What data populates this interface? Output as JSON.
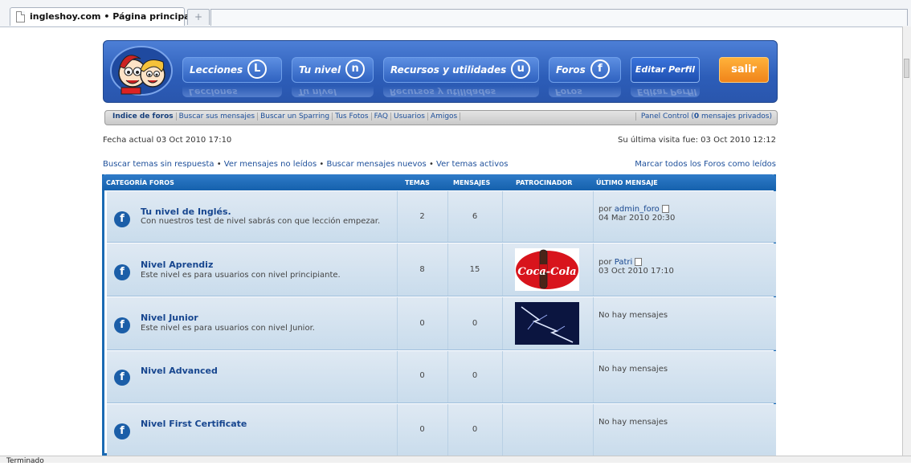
{
  "browser": {
    "tab_title": "ingleshoy.com • Página principal",
    "new_tab": "+"
  },
  "header": {
    "nav": [
      {
        "label": "Lecciones",
        "glyph": "L"
      },
      {
        "label": "Tu nivel",
        "glyph": "n"
      },
      {
        "label": "Recursos y utilidades",
        "glyph": "u"
      },
      {
        "label": "Foros",
        "glyph": "f"
      }
    ],
    "edit_profile": "Editar Perfil",
    "logout": "salir"
  },
  "linkbar": {
    "items": [
      "Indice de foros",
      "Buscar sus mensajes",
      "Buscar un Sparring",
      "Tus Fotos",
      "FAQ",
      "Usuarios",
      "Amigos"
    ],
    "panel_pre": "Panel Control (",
    "panel_count": "0",
    "panel_post": " mensajes privados)"
  },
  "info": {
    "current_date": "Fecha actual 03 Oct 2010 17:10",
    "last_visit": "Su última visita fue: 03 Oct 2010 12:12"
  },
  "quicklinks": [
    "Buscar temas sin respuesta",
    "Ver mensajes no leídos",
    "Buscar mensajes nuevos",
    "Ver temas activos"
  ],
  "mark_all": "Marcar todos los Foros como leídos",
  "table": {
    "headers": {
      "category": "CATEGORÍA FOROS",
      "topics": "TEMAS",
      "posts": "MENSAJES",
      "sponsor": "PATROCINADOR",
      "last": "ÚLTIMO MENSAJE"
    },
    "rows": [
      {
        "name": "Tu nivel de Inglés.",
        "desc": "Con nuestros test de nivel sabrás con que lección empezar.",
        "topics": "2",
        "posts": "6",
        "last_by": "por ",
        "last_author": "admin_foro",
        "last_date": "04 Mar 2010 20:30",
        "sponsor": ""
      },
      {
        "name": "Nivel Aprendiz",
        "desc": "Este nivel es para usuarios con nivel principiante.",
        "topics": "8",
        "posts": "15",
        "last_by": "por ",
        "last_author": "Patri",
        "last_date": "03 Oct 2010 17:10",
        "sponsor": "Coca-Cola"
      },
      {
        "name": "Nivel Junior",
        "desc": "Este nivel es para usuarios con nivel Junior.",
        "topics": "0",
        "posts": "0",
        "last_text": "No hay mensajes",
        "sponsor": "lightning"
      },
      {
        "name": "Nivel Advanced",
        "desc": "",
        "topics": "0",
        "posts": "0",
        "last_text": "No hay mensajes",
        "sponsor": ""
      },
      {
        "name": "Nivel First Certificate",
        "desc": "",
        "topics": "0",
        "posts": "0",
        "last_text": "No hay mensajes",
        "sponsor": ""
      }
    ]
  },
  "status": "Terminado",
  "colors": {
    "accent": "#1a6ab4",
    "banner": "#2c5db8",
    "logout": "#f0841a"
  },
  "icons": {
    "forum": "forum-f-icon",
    "goto": "goto-post-icon",
    "doc": "document-icon"
  }
}
